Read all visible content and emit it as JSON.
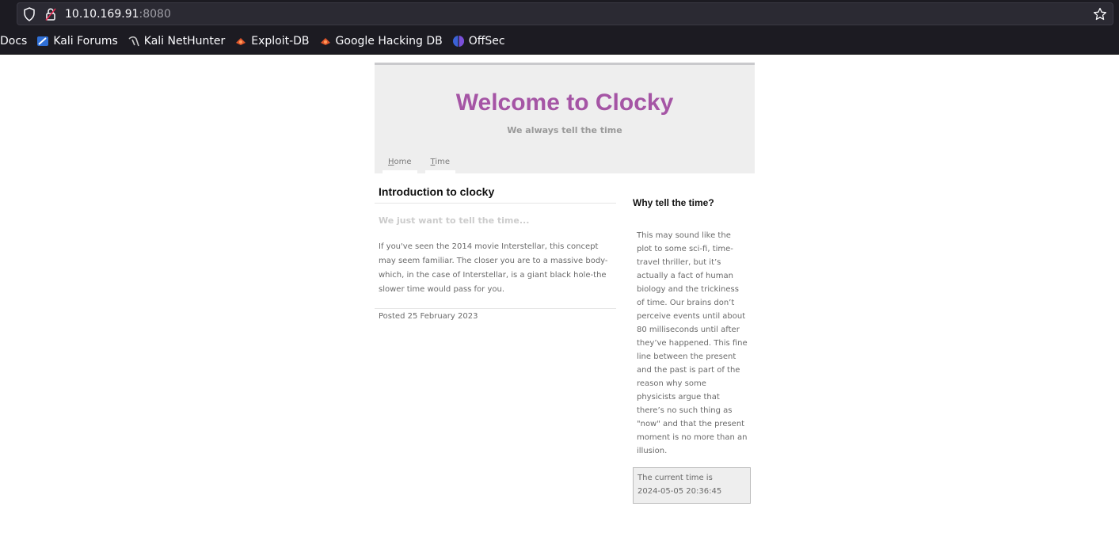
{
  "browser": {
    "url_host": "10.10.169.91",
    "url_port": ":8080",
    "bookmarks": [
      {
        "label": "Docs",
        "icon": "none"
      },
      {
        "label": "Kali Forums",
        "icon": "kali-forums-icon"
      },
      {
        "label": "Kali NetHunter",
        "icon": "kali-nethunter-icon"
      },
      {
        "label": "Exploit-DB",
        "icon": "exploit-db-icon"
      },
      {
        "label": "Google Hacking DB",
        "icon": "ghdb-icon"
      },
      {
        "label": "OffSec",
        "icon": "offsec-icon"
      }
    ]
  },
  "site": {
    "title": "Welcome to Clocky",
    "subtitle": "We always tell the time",
    "nav": [
      {
        "first": "H",
        "rest": "ome"
      },
      {
        "first": "T",
        "rest": "ime"
      }
    ]
  },
  "post": {
    "title": "Introduction to clocky",
    "lead": "We just want to tell the time...",
    "body": "If you've seen the 2014 movie Interstellar, this concept may seem familiar. The closer you are to a massive body-which, in the case of Interstellar, is a giant black hole-the slower time would pass for you.",
    "date": "Posted 25 February 2023"
  },
  "sidebar": {
    "title": "Why tell the time?",
    "body": "This may sound like the plot to some sci-fi, time-travel thriller, but it’s actually a fact of human biology and the trickiness of time. Our brains don’t perceive events until about 80 milliseconds until after they’ve happened. This fine line between the present and the past is part of the reason why some physicists argue that there’s no such thing as \"now\" and that the present moment is no more than an illusion.",
    "time_label": "The current time is",
    "time_value": "2024-05-05 20:36:45"
  },
  "colors": {
    "title": "#a555a5",
    "header_bg": "#eeeeee",
    "chrome_bg": "#1c1b22"
  }
}
